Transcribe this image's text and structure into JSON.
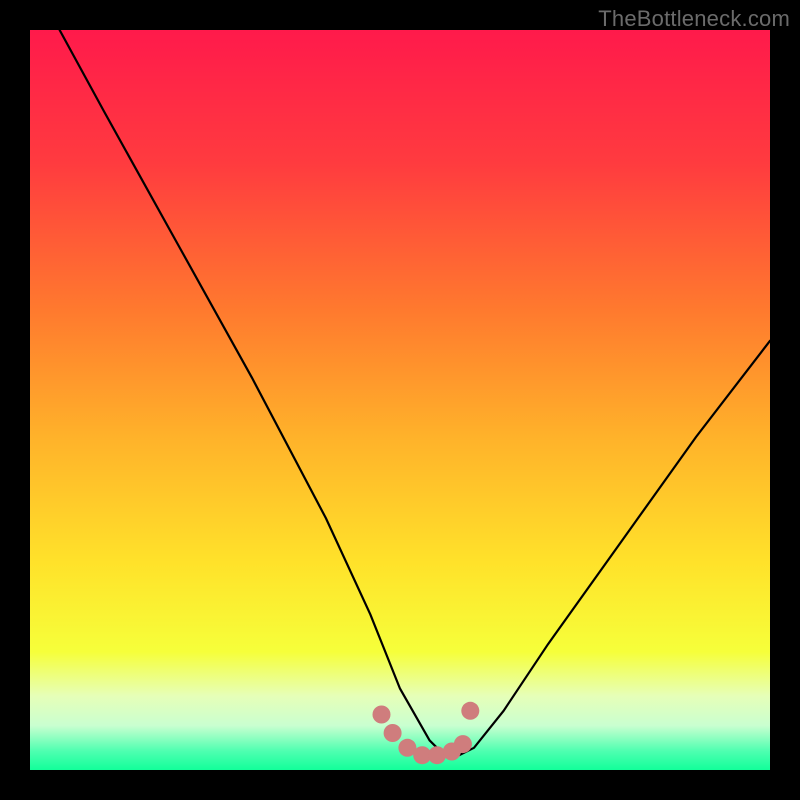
{
  "watermark": "TheBottleneck.com",
  "chart_data": {
    "type": "line",
    "title": "",
    "xlabel": "",
    "ylabel": "",
    "xlim": [
      0,
      100
    ],
    "ylim": [
      0,
      100
    ],
    "series": [
      {
        "name": "curve",
        "x": [
          4,
          10,
          20,
          30,
          40,
          46,
          50,
          54,
          56,
          58,
          60,
          64,
          70,
          80,
          90,
          100
        ],
        "y": [
          100,
          89,
          71,
          53,
          34,
          21,
          11,
          4,
          2,
          2,
          3,
          8,
          17,
          31,
          45,
          58
        ]
      }
    ],
    "markers": {
      "name": "highlight-dots",
      "color": "#cf7d7d",
      "x": [
        47.5,
        49,
        51,
        53,
        55,
        57,
        58.5,
        59.5
      ],
      "y": [
        7.5,
        5,
        3,
        2,
        2,
        2.5,
        3.5,
        8
      ]
    },
    "gradient_stops": [
      {
        "offset": 0.0,
        "color": "#ff1a4b"
      },
      {
        "offset": 0.18,
        "color": "#ff3b3f"
      },
      {
        "offset": 0.38,
        "color": "#ff7a2e"
      },
      {
        "offset": 0.55,
        "color": "#ffb22a"
      },
      {
        "offset": 0.72,
        "color": "#ffe22a"
      },
      {
        "offset": 0.84,
        "color": "#f6ff3a"
      },
      {
        "offset": 0.9,
        "color": "#e6ffb8"
      },
      {
        "offset": 0.94,
        "color": "#c9ffd0"
      },
      {
        "offset": 0.975,
        "color": "#4dffb0"
      },
      {
        "offset": 1.0,
        "color": "#12ff9a"
      }
    ]
  }
}
